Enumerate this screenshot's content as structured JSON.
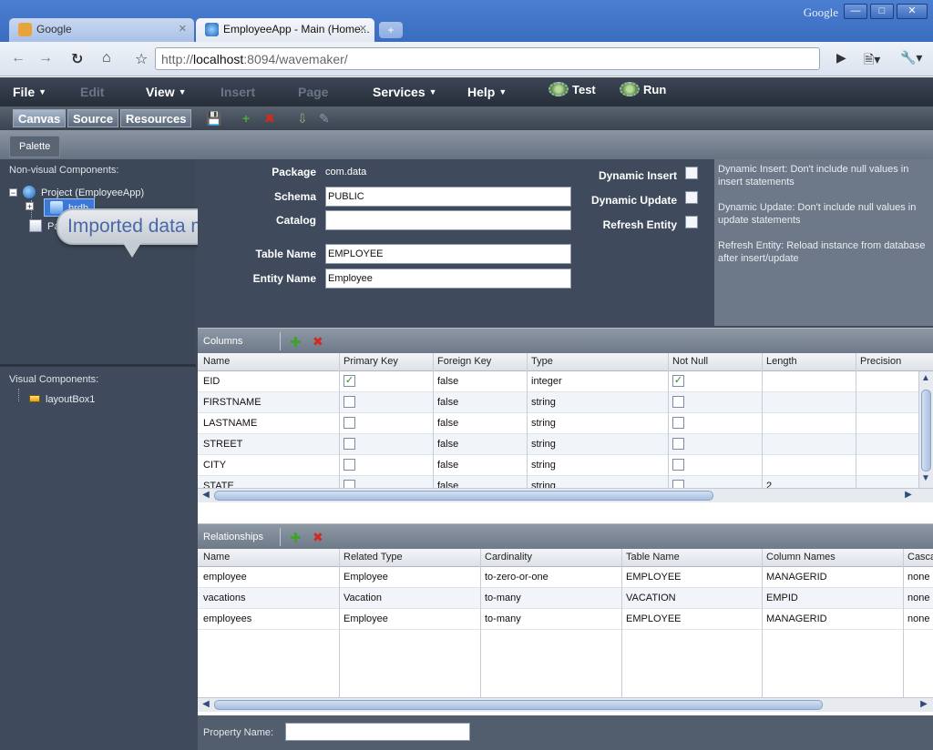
{
  "browser": {
    "window_brand": "Google",
    "tabs": [
      {
        "title": "Google",
        "favicon_color": "#e8a33a"
      },
      {
        "title": "EmployeeApp - Main (Home...",
        "favicon_color": "#2a6ec0"
      }
    ],
    "url_scheme": "http://",
    "url_host": "localhost",
    "url_rest": ":8094/wavemaker/"
  },
  "menus": [
    "File",
    "Edit",
    "View",
    "Insert",
    "Page",
    "Services",
    "Help"
  ],
  "run_buttons": {
    "test": "Test",
    "run": "Run"
  },
  "toolbar_tabs": [
    "Canvas",
    "Source",
    "Resources"
  ],
  "palette_tab": "Palette",
  "callout": "Imported data model",
  "left": {
    "nonvisual_label": "Non-visual Components:",
    "project": "Project (EmployeeApp)",
    "hrdb": "hrdb",
    "page": "Page (Main)",
    "visual_label": "Visual Components:",
    "layout": "layoutBox1"
  },
  "entity": {
    "package_label": "Package",
    "package_value": "com.data",
    "schema_label": "Schema",
    "schema_value": "PUBLIC",
    "catalog_label": "Catalog",
    "catalog_value": "",
    "table_label": "Table Name",
    "table_value": "EMPLOYEE",
    "entity_label": "Entity Name",
    "entity_value": "Employee",
    "dyn_insert": "Dynamic Insert",
    "dyn_update": "Dynamic Update",
    "refresh": "Refresh Entity",
    "help": [
      "Dynamic Insert: Don't include null values in insert statements",
      "Dynamic Update: Don't include null values in update statements",
      "Refresh Entity: Reload instance from database after insert/update"
    ]
  },
  "columns": {
    "title": "Columns",
    "headers": [
      "Name",
      "Primary Key",
      "Foreign Key",
      "Type",
      "Not Null",
      "Length",
      "Precision"
    ],
    "rows": [
      {
        "name": "EID",
        "pk": true,
        "fk": "false",
        "type": "integer",
        "notnull": true,
        "length": ""
      },
      {
        "name": "FIRSTNAME",
        "pk": false,
        "fk": "false",
        "type": "string",
        "notnull": false,
        "length": ""
      },
      {
        "name": "LASTNAME",
        "pk": false,
        "fk": "false",
        "type": "string",
        "notnull": false,
        "length": ""
      },
      {
        "name": "STREET",
        "pk": false,
        "fk": "false",
        "type": "string",
        "notnull": false,
        "length": ""
      },
      {
        "name": "CITY",
        "pk": false,
        "fk": "false",
        "type": "string",
        "notnull": false,
        "length": ""
      },
      {
        "name": "STATE",
        "pk": false,
        "fk": "false",
        "type": "string",
        "notnull": false,
        "length": "2"
      }
    ]
  },
  "relationships": {
    "title": "Relationships",
    "headers": [
      "Name",
      "Related Type",
      "Cardinality",
      "Table Name",
      "Column Names",
      "Casca"
    ],
    "rows": [
      [
        "employee",
        "Employee",
        "to-zero-or-one",
        "EMPLOYEE",
        "MANAGERID",
        "none"
      ],
      [
        "vacations",
        "Vacation",
        "to-many",
        "VACATION",
        "EMPID",
        "none"
      ],
      [
        "employees",
        "Employee",
        "to-many",
        "EMPLOYEE",
        "MANAGERID",
        "none"
      ]
    ]
  },
  "property_label": "Property Name:"
}
